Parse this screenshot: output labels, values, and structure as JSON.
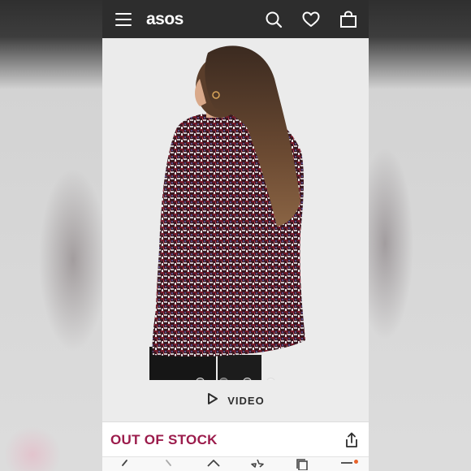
{
  "header": {
    "logo": "asos",
    "icons": [
      "menu-icon",
      "search-icon",
      "heart-icon",
      "bag-icon"
    ]
  },
  "carousel": {
    "count": 4,
    "active_index": 1
  },
  "video": {
    "label": "VIDEO"
  },
  "product": {
    "stock_status": "OUT OF STOCK",
    "stock_color": "#9b1b4b"
  },
  "colors": {
    "topbar": "#2d2d2d",
    "accent": "#9b1b4b",
    "badge": "#e8632b"
  },
  "bottom_nav": {
    "icons": [
      "back-icon",
      "forward-icon",
      "home-icon",
      "star-icon",
      "tabs-icon",
      "menu-icon"
    ]
  }
}
